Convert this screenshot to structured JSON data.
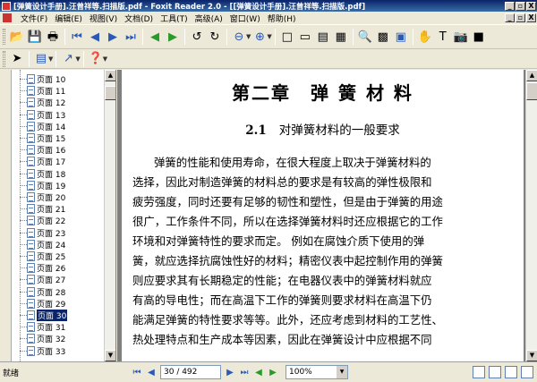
{
  "window": {
    "title": "[弹簧设计手册].汪曾祥等.扫描版.pdf - Foxit Reader 2.0 - [[弹簧设计手册].汪曾祥等.扫描版.pdf]",
    "minimize": "_",
    "restore": "▫",
    "close": "X"
  },
  "menu": {
    "items": [
      "文件(F)",
      "编辑(E)",
      "视图(V)",
      "文档(D)",
      "工具(T)",
      "高级(A)",
      "窗口(W)",
      "帮助(H)"
    ]
  },
  "sidebar": {
    "items": [
      "页面 10",
      "页面 11",
      "页面 12",
      "页面 13",
      "页面 14",
      "页面 15",
      "页面 16",
      "页面 17",
      "页面 18",
      "页面 19",
      "页面 20",
      "页面 21",
      "页面 22",
      "页面 23",
      "页面 24",
      "页面 25",
      "页面 26",
      "页面 27",
      "页面 28",
      "页面 29",
      "页面 30",
      "页面 31",
      "页面 32",
      "页面 33"
    ],
    "selected": "页面 30"
  },
  "document": {
    "chapter": "第二章　弹 簧 材 料",
    "section_num": "2.1",
    "section_title": "对弹簧材料的一般要求",
    "lines": [
      "弹簧的性能和使用寿命，在很大程度上取决于弹簧材料的",
      "选择，因此对制造弹簧的材料总的要求是有较高的弹性极限和",
      "疲劳强度，同时还要有足够的韧性和塑性，但是由于弹簧的用途",
      "很广，工作条件不同，所以在选择弹簧材料时还应根据它的工作",
      "环境和对弹簧特性的要求而定。 例如在腐蚀介质下使用的弹",
      "簧，就应选择抗腐蚀性好的材料；精密仪表中起控制作用的弹簧",
      "则应要求其有长期稳定的性能；在电器仪表中的弹簧材料就应",
      "有高的导电性；而在高温下工作的弹簧则要求材料在高温下仍",
      "能满足弹簧的特性要求等等。此外，还应考虑到材料的工艺性、",
      "热处理特点和生产成本等因素，因此在弹簧设计中应根据不同"
    ]
  },
  "status": {
    "text": "就绪",
    "page_display": "30 / 492",
    "zoom": "100%"
  },
  "colors": {
    "titlebar": "#0a246a",
    "selection": "#0a246a",
    "chrome": "#ece9d8"
  }
}
